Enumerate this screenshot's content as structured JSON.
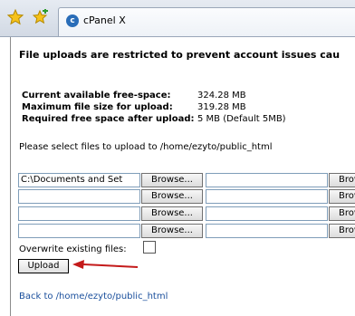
{
  "browser": {
    "tab_title": "cPanel X",
    "tab_logo_glyph": "c",
    "icons": [
      "star-icon",
      "add-bookmark-icon",
      "cpanel-logo-icon"
    ]
  },
  "page": {
    "heading": "File uploads are restricted to prevent account issues cau",
    "info": [
      {
        "label": "Current available free-space:",
        "value": "324.28 MB"
      },
      {
        "label": "Maximum file size for upload:",
        "value": "319.28 MB"
      },
      {
        "label": "Required free space after upload:",
        "value": "5 MB (Default 5MB)"
      }
    ],
    "select_text": "Please select files to upload to /home/ezyto/public_html",
    "file_rows": [
      {
        "left_value": "C:\\Documents and Set",
        "right_value": ""
      },
      {
        "left_value": "",
        "right_value": ""
      },
      {
        "left_value": "",
        "right_value": ""
      },
      {
        "left_value": "",
        "right_value": ""
      }
    ],
    "browse_label": "Browse...",
    "browse_cut_label": "Brov",
    "overwrite_label": "Overwrite existing files:",
    "overwrite_checked": false,
    "upload_label": "Upload",
    "back_link": "Back to /home/ezyto/public_html",
    "colors": {
      "link": "#1a4f9c",
      "arrow": "#c41a1a"
    }
  }
}
